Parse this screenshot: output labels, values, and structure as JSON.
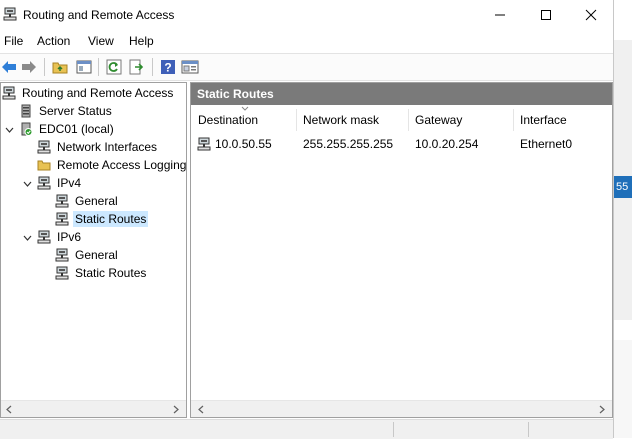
{
  "window": {
    "title": "Routing and Remote Access",
    "controls": {
      "minimize": "—",
      "maximize": "☐",
      "close": "✕"
    }
  },
  "menu": {
    "items": [
      "File",
      "Action",
      "View",
      "Help"
    ]
  },
  "toolbar": {
    "buttons": [
      "back-icon",
      "forward-icon",
      "up-folder-icon",
      "show-hide-tree-icon",
      "refresh-icon",
      "export-list-icon",
      "help-icon",
      "properties-icon"
    ]
  },
  "tree": {
    "root": "Routing and Remote Access",
    "server_status": "Server Status",
    "server": "EDC01 (local)",
    "network_interfaces": "Network Interfaces",
    "remote_access_logging": "Remote Access Logging",
    "ipv4": "IPv4",
    "ipv4_general": "General",
    "ipv4_static_routes": "Static Routes",
    "ipv6": "IPv6",
    "ipv6_general": "General",
    "ipv6_static_routes": "Static Routes",
    "selected": "ipv4_static_routes"
  },
  "detail": {
    "header": "Static Routes",
    "columns": [
      "Destination",
      "Network mask",
      "Gateway",
      "Interface"
    ],
    "rows": [
      {
        "destination": "10.0.50.55",
        "mask": "255.255.255.255",
        "gateway": "10.0.20.254",
        "interface": "Ethernet0"
      }
    ]
  },
  "behind_window": {
    "tag_text": "55"
  },
  "colors": {
    "selection": "#cce8ff",
    "header_bar": "#7a7a7a",
    "accent_blue": "#1f6fb9"
  }
}
